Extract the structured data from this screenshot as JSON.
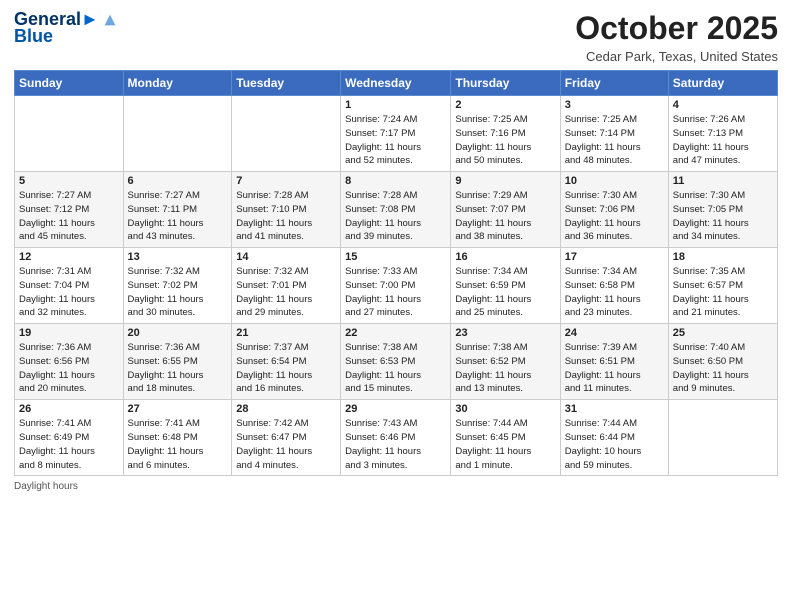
{
  "header": {
    "logo_line1": "General",
    "logo_line2": "Blue",
    "month_title": "October 2025",
    "location": "Cedar Park, Texas, United States"
  },
  "days_of_week": [
    "Sunday",
    "Monday",
    "Tuesday",
    "Wednesday",
    "Thursday",
    "Friday",
    "Saturday"
  ],
  "weeks": [
    [
      {
        "day": "",
        "info": ""
      },
      {
        "day": "",
        "info": ""
      },
      {
        "day": "",
        "info": ""
      },
      {
        "day": "1",
        "info": "Sunrise: 7:24 AM\nSunset: 7:17 PM\nDaylight: 11 hours\nand 52 minutes."
      },
      {
        "day": "2",
        "info": "Sunrise: 7:25 AM\nSunset: 7:16 PM\nDaylight: 11 hours\nand 50 minutes."
      },
      {
        "day": "3",
        "info": "Sunrise: 7:25 AM\nSunset: 7:14 PM\nDaylight: 11 hours\nand 48 minutes."
      },
      {
        "day": "4",
        "info": "Sunrise: 7:26 AM\nSunset: 7:13 PM\nDaylight: 11 hours\nand 47 minutes."
      }
    ],
    [
      {
        "day": "5",
        "info": "Sunrise: 7:27 AM\nSunset: 7:12 PM\nDaylight: 11 hours\nand 45 minutes."
      },
      {
        "day": "6",
        "info": "Sunrise: 7:27 AM\nSunset: 7:11 PM\nDaylight: 11 hours\nand 43 minutes."
      },
      {
        "day": "7",
        "info": "Sunrise: 7:28 AM\nSunset: 7:10 PM\nDaylight: 11 hours\nand 41 minutes."
      },
      {
        "day": "8",
        "info": "Sunrise: 7:28 AM\nSunset: 7:08 PM\nDaylight: 11 hours\nand 39 minutes."
      },
      {
        "day": "9",
        "info": "Sunrise: 7:29 AM\nSunset: 7:07 PM\nDaylight: 11 hours\nand 38 minutes."
      },
      {
        "day": "10",
        "info": "Sunrise: 7:30 AM\nSunset: 7:06 PM\nDaylight: 11 hours\nand 36 minutes."
      },
      {
        "day": "11",
        "info": "Sunrise: 7:30 AM\nSunset: 7:05 PM\nDaylight: 11 hours\nand 34 minutes."
      }
    ],
    [
      {
        "day": "12",
        "info": "Sunrise: 7:31 AM\nSunset: 7:04 PM\nDaylight: 11 hours\nand 32 minutes."
      },
      {
        "day": "13",
        "info": "Sunrise: 7:32 AM\nSunset: 7:02 PM\nDaylight: 11 hours\nand 30 minutes."
      },
      {
        "day": "14",
        "info": "Sunrise: 7:32 AM\nSunset: 7:01 PM\nDaylight: 11 hours\nand 29 minutes."
      },
      {
        "day": "15",
        "info": "Sunrise: 7:33 AM\nSunset: 7:00 PM\nDaylight: 11 hours\nand 27 minutes."
      },
      {
        "day": "16",
        "info": "Sunrise: 7:34 AM\nSunset: 6:59 PM\nDaylight: 11 hours\nand 25 minutes."
      },
      {
        "day": "17",
        "info": "Sunrise: 7:34 AM\nSunset: 6:58 PM\nDaylight: 11 hours\nand 23 minutes."
      },
      {
        "day": "18",
        "info": "Sunrise: 7:35 AM\nSunset: 6:57 PM\nDaylight: 11 hours\nand 21 minutes."
      }
    ],
    [
      {
        "day": "19",
        "info": "Sunrise: 7:36 AM\nSunset: 6:56 PM\nDaylight: 11 hours\nand 20 minutes."
      },
      {
        "day": "20",
        "info": "Sunrise: 7:36 AM\nSunset: 6:55 PM\nDaylight: 11 hours\nand 18 minutes."
      },
      {
        "day": "21",
        "info": "Sunrise: 7:37 AM\nSunset: 6:54 PM\nDaylight: 11 hours\nand 16 minutes."
      },
      {
        "day": "22",
        "info": "Sunrise: 7:38 AM\nSunset: 6:53 PM\nDaylight: 11 hours\nand 15 minutes."
      },
      {
        "day": "23",
        "info": "Sunrise: 7:38 AM\nSunset: 6:52 PM\nDaylight: 11 hours\nand 13 minutes."
      },
      {
        "day": "24",
        "info": "Sunrise: 7:39 AM\nSunset: 6:51 PM\nDaylight: 11 hours\nand 11 minutes."
      },
      {
        "day": "25",
        "info": "Sunrise: 7:40 AM\nSunset: 6:50 PM\nDaylight: 11 hours\nand 9 minutes."
      }
    ],
    [
      {
        "day": "26",
        "info": "Sunrise: 7:41 AM\nSunset: 6:49 PM\nDaylight: 11 hours\nand 8 minutes."
      },
      {
        "day": "27",
        "info": "Sunrise: 7:41 AM\nSunset: 6:48 PM\nDaylight: 11 hours\nand 6 minutes."
      },
      {
        "day": "28",
        "info": "Sunrise: 7:42 AM\nSunset: 6:47 PM\nDaylight: 11 hours\nand 4 minutes."
      },
      {
        "day": "29",
        "info": "Sunrise: 7:43 AM\nSunset: 6:46 PM\nDaylight: 11 hours\nand 3 minutes."
      },
      {
        "day": "30",
        "info": "Sunrise: 7:44 AM\nSunset: 6:45 PM\nDaylight: 11 hours\nand 1 minute."
      },
      {
        "day": "31",
        "info": "Sunrise: 7:44 AM\nSunset: 6:44 PM\nDaylight: 10 hours\nand 59 minutes."
      },
      {
        "day": "",
        "info": ""
      }
    ]
  ],
  "footer": {
    "daylight_label": "Daylight hours"
  }
}
